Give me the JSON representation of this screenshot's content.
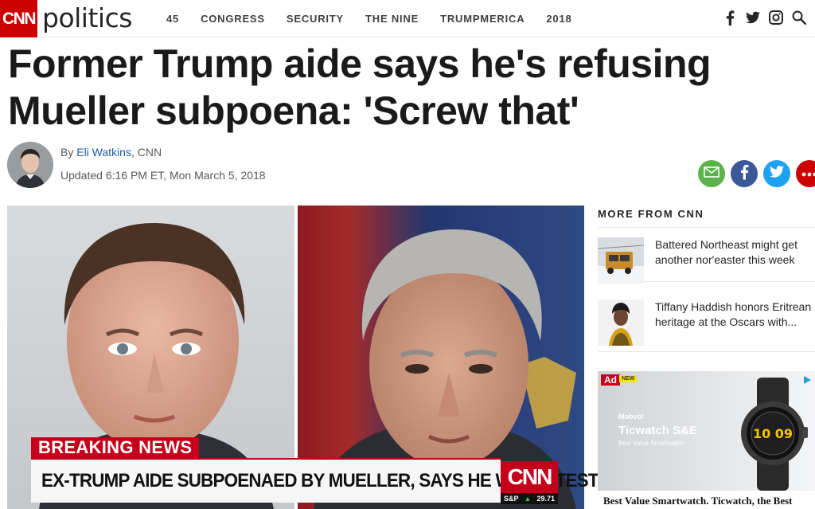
{
  "nav": {
    "logo": "CNN",
    "section": "politics",
    "links": [
      "45",
      "CONGRESS",
      "SECURITY",
      "THE NINE",
      "TRUMPMERICA",
      "2018"
    ],
    "icons": [
      "facebook-icon",
      "twitter-icon",
      "instagram-icon",
      "search-icon"
    ]
  },
  "article": {
    "headline": "Former Trump aide says he's refusing Mueller subpoena: 'Screw that'",
    "byline_prefix": "By ",
    "author": "Eli Watkins",
    "byline_suffix": ", CNN",
    "updated": "Updated 6:16 PM ET, Mon March 5, 2018"
  },
  "share": [
    "email-icon",
    "facebook-icon",
    "twitter-icon",
    "more-icon"
  ],
  "broadcast": {
    "breaking": "BREAKING NEWS",
    "ticker": "EX-TRUMP AIDE SUBPOENAED BY MUELLER, SAYS HE WON'T TESTIFY",
    "bug": "CNN",
    "index_name": "S&P",
    "index_value": "29.71"
  },
  "sidebar": {
    "title": "MORE FROM CNN",
    "stories": [
      {
        "text": "Battered Northeast might get another nor'easter this week"
      },
      {
        "text": "Tiffany Haddish honors Eritrean heritage at the Oscars with..."
      }
    ]
  },
  "ad": {
    "tag": "Ad",
    "new_badge": "NEW",
    "brand": "Mobvoi",
    "title": "Ticwatch S&E",
    "subtitle": "Best Value Smartwatch",
    "caption": "Best Value Smartwatch. Ticwatch, the Best",
    "watch_time": "10 09"
  },
  "colors": {
    "brand_red": "#cc0000",
    "link_blue": "#1c5ba8"
  }
}
